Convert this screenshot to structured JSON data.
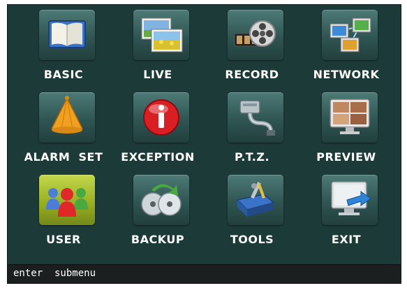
{
  "menu": {
    "items": [
      {
        "label": "BASIC",
        "icon": "book-icon"
      },
      {
        "label": "LIVE",
        "icon": "photo-frames-icon"
      },
      {
        "label": "RECORD",
        "icon": "film-reel-icon"
      },
      {
        "label": "NETWORK",
        "icon": "network-computers-icon"
      },
      {
        "label": "ALARM  SET",
        "icon": "alarm-bell-icon"
      },
      {
        "label": "EXCEPTION",
        "icon": "info-icon"
      },
      {
        "label": "P.T.Z.",
        "icon": "ptz-camera-cable-icon"
      },
      {
        "label": "PREVIEW",
        "icon": "monitor-preview-icon"
      },
      {
        "label": "USER",
        "icon": "users-icon"
      },
      {
        "label": "BACKUP",
        "icon": "backup-disc-icon"
      },
      {
        "label": "TOOLS",
        "icon": "toolbox-icon"
      },
      {
        "label": "EXIT",
        "icon": "exit-monitor-icon"
      }
    ],
    "selected": "USER"
  },
  "status_bar": {
    "text": "enter  submenu"
  },
  "colors": {
    "background": "#1c3a38",
    "tile": "#2f5552",
    "selected_tile": "#94ad20",
    "status_bar": "#1b1f1f"
  }
}
